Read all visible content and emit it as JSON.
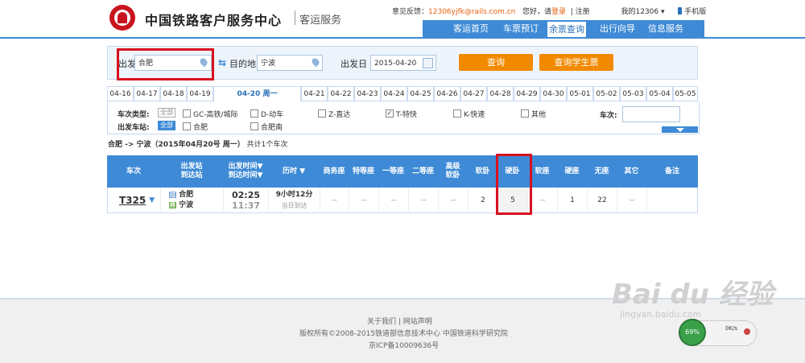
{
  "header": {
    "title": "中国铁路客户服务中心",
    "subtitle": "客运服务",
    "feedback_label": "意见反馈：",
    "feedback_email": "12306yjfk@rails.com.cn",
    "greeting": "您好，请",
    "login": "登录",
    "register": "注册",
    "my12306": "我的12306",
    "mobile": "手机版"
  },
  "nav": {
    "items": [
      "客运首页",
      "车票预订",
      "余票查询",
      "出行向导",
      "信息服务"
    ],
    "active": "余票查询"
  },
  "search": {
    "from_label": "出发地",
    "from_value": "合肥",
    "to_label": "目的地",
    "to_value": "宁波",
    "date_label": "出发日",
    "date_value": "2015-04-20",
    "query_button": "查询",
    "student_button": "查询学生票"
  },
  "dates": [
    "04-16",
    "04-17",
    "04-18",
    "04-19",
    "04-20 周一",
    "04-21",
    "04-22",
    "04-23",
    "04-24",
    "04-25",
    "04-26",
    "04-27",
    "04-28",
    "04-29",
    "04-30",
    "05-01",
    "05-02",
    "05-03",
    "05-04",
    "05-05"
  ],
  "filters": {
    "type_label": "车次类型:",
    "all1": "全部",
    "types": [
      "GC-高铁/城际",
      "D-动车",
      "Z-直达",
      "T-特快",
      "K-快速",
      "其他"
    ],
    "station_label": "出发车站:",
    "all2": "全部",
    "stations": [
      "合肥",
      "合肥南"
    ],
    "train_no_label": "车次:"
  },
  "summary": {
    "route": "合肥 -> 宁波（2015年04月20号 周一）",
    "count": "共计1个车次"
  },
  "table": {
    "headers": [
      "车次",
      "出发站\n到达站",
      "出发时间▼\n到达时间▼",
      "历时 ▼",
      "商务座",
      "特等座",
      "一等座",
      "二等座",
      "高级\n软卧",
      "软卧",
      "硬卧",
      "软座",
      "硬座",
      "无座",
      "其它",
      "备注"
    ],
    "row": {
      "train": "T325",
      "from_badge": "过",
      "from": "合肥",
      "to_badge": "终",
      "to": "宁波",
      "depart": "02:25",
      "arrive": "11:37",
      "duration": "9小时12分",
      "arrival_note": "当日到达",
      "seats": [
        "--",
        "--",
        "--",
        "--",
        "--",
        "2",
        "5",
        "--",
        "1",
        "22",
        "--",
        ""
      ]
    }
  },
  "footer": {
    "links": "关于我们 | 网站声明",
    "copyright": "版权所有©2008-2015铁道部信息技术中心   中国铁道科学研究院",
    "icp": "京ICP备10009636号"
  },
  "watermark": {
    "brand": "Bai du 经验",
    "url": "jingyan.baidu.com"
  },
  "speed": {
    "percent": "69%",
    "rate": "0K/s"
  }
}
